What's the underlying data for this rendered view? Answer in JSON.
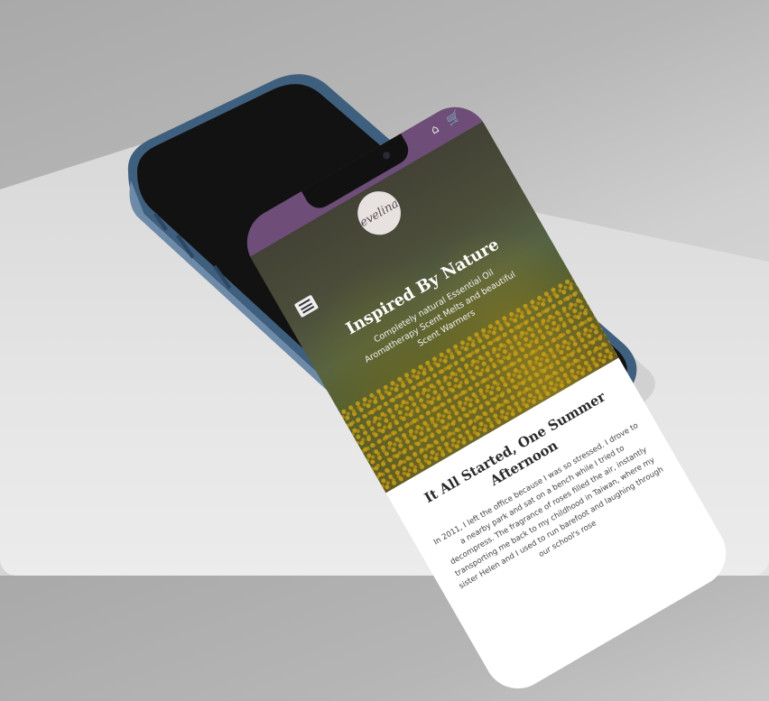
{
  "app": {
    "logo_text": "evelina",
    "header_icons": "⌂ 🛒"
  },
  "hero": {
    "title": "Inspired By Nature",
    "subtitle": "Completely natural Essential Oil Aromatherapy Scent Melts and beautiful Scent Warmers"
  },
  "story": {
    "title": "It All Started, One Summer Afternoon",
    "body": "In 2011, I left the office because I was so stressed. I drove to a nearby park and sat on a bench while I tried to decompress. The fragrance of roses filled the air, instantly transporting me back to my childhood in Taiwan, where my sister Helen and I used to run barefoot and laughing through our school's rose"
  },
  "colors": {
    "topbar": "#6e4e78",
    "phone_frame": "#3f5f7e"
  }
}
